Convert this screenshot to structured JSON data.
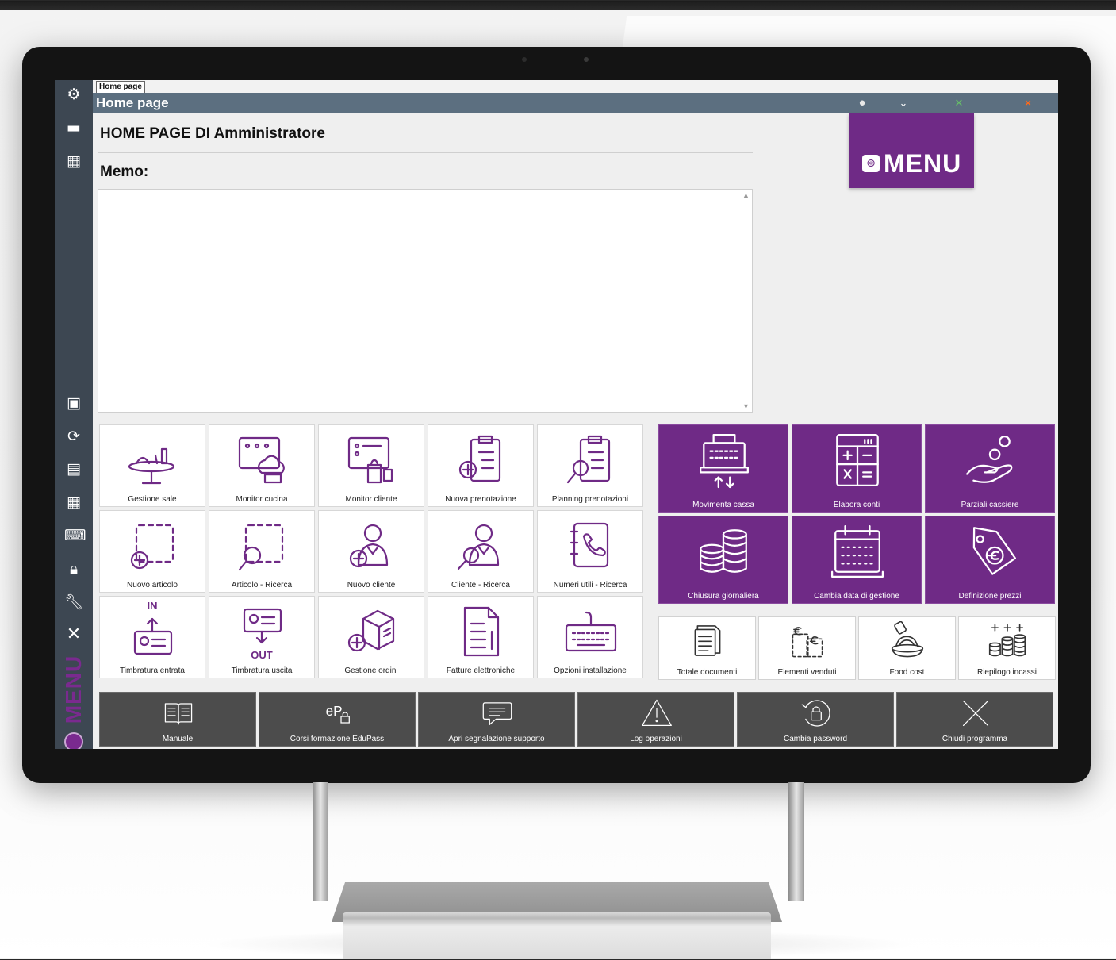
{
  "tab": {
    "label": "Home page"
  },
  "window": {
    "title": "Home page",
    "close_symbol": "×"
  },
  "page": {
    "heading": "HOME PAGE DI Amministratore",
    "memo_label": "Memo:",
    "memo_text": ""
  },
  "brand": {
    "logo_text": "MENU",
    "side_text": "MENU",
    "color": "#6f2a86"
  },
  "tiles_white": [
    {
      "label": "Gestione sale",
      "icon": "dining-table-icon"
    },
    {
      "label": "Monitor cucina",
      "icon": "chef-monitor-icon"
    },
    {
      "label": "Monitor cliente",
      "icon": "customer-monitor-icon"
    },
    {
      "label": "Nuova prenotazione",
      "icon": "new-booking-icon"
    },
    {
      "label": "Planning prenotazioni",
      "icon": "booking-search-icon"
    },
    {
      "label": "Nuovo articolo",
      "icon": "new-article-icon"
    },
    {
      "label": "Articolo - Ricerca",
      "icon": "article-search-icon"
    },
    {
      "label": "Nuovo cliente",
      "icon": "new-customer-icon"
    },
    {
      "label": "Cliente - Ricerca",
      "icon": "customer-search-icon"
    },
    {
      "label": "Numeri utili - Ricerca",
      "icon": "phonebook-icon"
    },
    {
      "label": "Timbratura entrata",
      "icon": "clock-in-icon",
      "tag": "IN"
    },
    {
      "label": "Timbratura uscita",
      "icon": "clock-out-icon",
      "tag": "OUT"
    },
    {
      "label": "Gestione ordini",
      "icon": "orders-box-icon"
    },
    {
      "label": "Fatture elettroniche",
      "icon": "e-invoice-icon"
    },
    {
      "label": "Opzioni installazione",
      "icon": "keyboard-icon"
    }
  ],
  "tiles_purple": [
    {
      "label": "Movimenta cassa",
      "icon": "cash-register-icon"
    },
    {
      "label": "Elabora conti",
      "icon": "calculator-icon"
    },
    {
      "label": "Parziali cassiere",
      "icon": "hand-coin-icon"
    },
    {
      "label": "Chiusura giornaliera",
      "icon": "coin-stacks-icon"
    },
    {
      "label": "Cambia data di gestione",
      "icon": "calendar-icon"
    },
    {
      "label": "Definizione prezzi",
      "icon": "price-tag-icon"
    }
  ],
  "tiles_small": [
    {
      "label": "Totale documenti",
      "icon": "documents-icon"
    },
    {
      "label": "Elementi venduti",
      "icon": "sold-items-icon"
    },
    {
      "label": "Food cost",
      "icon": "food-cost-icon"
    },
    {
      "label": "Riepilogo incassi",
      "icon": "cash-summary-icon"
    }
  ],
  "tiles_bottom": [
    {
      "label": "Manuale",
      "icon": "book-icon"
    },
    {
      "label": "Corsi formazione EduPass",
      "icon": "edupass-icon"
    },
    {
      "label": "Apri segnalazione supporto",
      "icon": "chat-icon"
    },
    {
      "label": "Log operazioni",
      "icon": "warning-icon"
    },
    {
      "label": "Cambia password",
      "icon": "lock-refresh-icon"
    },
    {
      "label": "Chiudi programma",
      "icon": "close-icon"
    }
  ]
}
